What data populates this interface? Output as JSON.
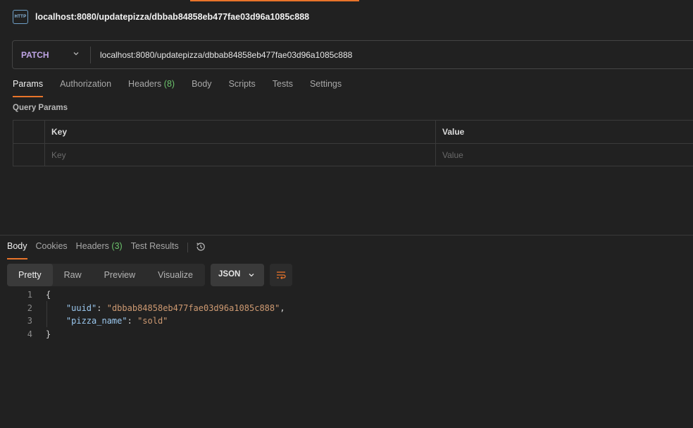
{
  "tab": {
    "icon_text": "HTTP",
    "title": "localhost:8080/updatepizza/dbbab84858eb477fae03d96a1085c888"
  },
  "request": {
    "method": "PATCH",
    "url": "localhost:8080/updatepizza/dbbab84858eb477fae03d96a1085c888"
  },
  "request_tabs": {
    "params": "Params",
    "authorization": "Authorization",
    "headers": "Headers",
    "headers_count": "(8)",
    "body": "Body",
    "scripts": "Scripts",
    "tests": "Tests",
    "settings": "Settings"
  },
  "query_params": {
    "label": "Query Params",
    "header_key": "Key",
    "header_value": "Value",
    "key_placeholder": "Key",
    "value_placeholder": "Value"
  },
  "response_tabs": {
    "body": "Body",
    "cookies": "Cookies",
    "headers": "Headers",
    "headers_count": "(3)",
    "test_results": "Test Results"
  },
  "view_modes": {
    "pretty": "Pretty",
    "raw": "Raw",
    "preview": "Preview",
    "visualize": "Visualize"
  },
  "format": "JSON",
  "code": {
    "line_numbers": [
      "1",
      "2",
      "3",
      "4"
    ],
    "open_brace": "{",
    "close_brace": "}",
    "key1": "\"uuid\"",
    "val1": "\"dbbab84858eb477fae03d96a1085c888\"",
    "key2": "\"pizza_name\"",
    "val2": "\"sold\""
  },
  "colors": {
    "accent": "#e8742a",
    "method": "#c0a5e6",
    "count": "#6cc36c",
    "json_key": "#9cc9f0",
    "json_string": "#ce9a72"
  }
}
